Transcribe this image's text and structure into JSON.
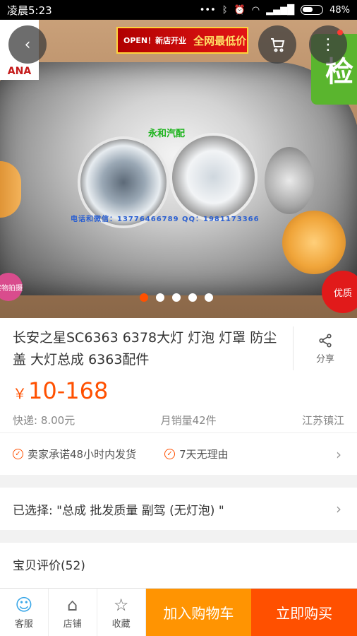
{
  "status_bar": {
    "time": "凌晨5:23",
    "battery": "48%"
  },
  "hero": {
    "banner_left": "OPEN！新店开业",
    "banner_right": "全网最低价",
    "brand_logo": "ANA",
    "shop_watermark": "永和汽配",
    "phone_watermark": "电话和微信：13776466789  QQ：1981173366",
    "badge_right": "检",
    "sticker_left": "实物拍摄",
    "quality_badge": "优质",
    "carousel_total": 5,
    "carousel_active": 0
  },
  "product": {
    "title": "长安之星SC6363 6378大灯  灯泡 灯罩 防尘盖 大灯总成 6363配件",
    "share_label": "分享",
    "price_symbol": "￥",
    "price": "10-168",
    "shipping": "快递: 8.00元",
    "monthly_sales": "月销量42件",
    "location": "江苏镇江"
  },
  "promise": {
    "item1": "卖家承诺48小时内发货",
    "item2": "7天无理由"
  },
  "selected": {
    "text": "已选择: \"总成 批发质量 副驾 (无灯泡) \""
  },
  "reviews": {
    "title": "宝贝评价(52)"
  },
  "bottom_bar": {
    "service": "客服",
    "shop": "店铺",
    "favorite": "收藏",
    "add_to_cart": "加入购物车",
    "buy_now": "立即购买"
  },
  "colors": {
    "accent": "#ff5000",
    "cart": "#ff9402",
    "service_icon": "#3aa7e8"
  }
}
